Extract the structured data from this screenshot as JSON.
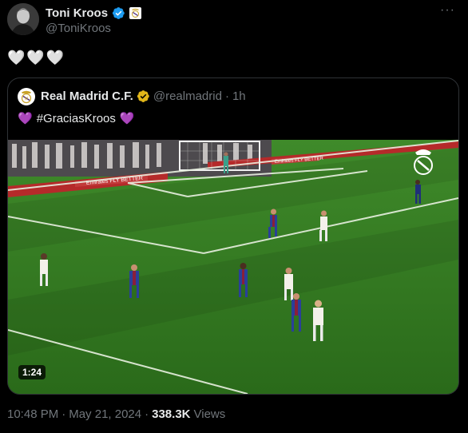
{
  "author": {
    "display_name": "Toni Kroos",
    "handle": "@ToniKroos",
    "verified": true,
    "affiliate_badge": "real-madrid-crest"
  },
  "more_menu": "···",
  "tweet": {
    "text": "🤍🤍🤍"
  },
  "quoted": {
    "display_name": "Real Madrid C.F.",
    "handle": "@realmadrid",
    "separator": "·",
    "time": "1h",
    "verified_color": "#e2b719",
    "text": "#GraciasKroos",
    "heart_emoji": "💜",
    "media": {
      "type": "video",
      "duration": "1:24",
      "board_text_1": "Emirates FLY BETTER",
      "board_text_2": "Emirates FLY BETTER"
    }
  },
  "footer": {
    "time": "10:48 PM",
    "separator_1": "·",
    "date": "May 21, 2024",
    "separator_2": "·",
    "views_count": "338.3K",
    "views_label": "Views"
  },
  "colors": {
    "background": "#000000",
    "text_primary": "#e7e9ea",
    "text_secondary": "#71767b",
    "verified_blue": "#1d9bf0",
    "border": "#2f3336"
  }
}
